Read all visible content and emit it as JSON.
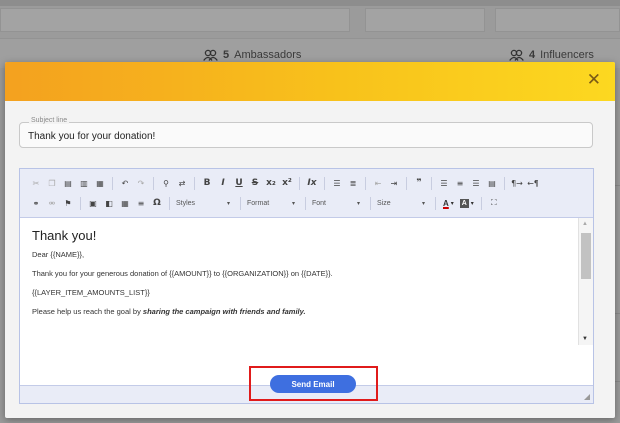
{
  "background": {
    "stats": [
      {
        "icon": "people-icon",
        "count": "5",
        "label": "Ambassadors"
      },
      {
        "icon": "people-icon",
        "count": "4",
        "label": "Influencers"
      }
    ]
  },
  "modal": {
    "close_glyph": "✕",
    "header_gradient": [
      "#f4a11f",
      "#fcd820"
    ],
    "subject": {
      "label": "Subject line",
      "value": "Thank you for your donation!"
    },
    "toolbar": {
      "row1": [
        "cut-icon",
        "copy-icon",
        "paste-icon",
        "paste-text-icon",
        "paste-word-icon",
        "undo-icon",
        "redo-icon",
        "find-icon",
        "replace-icon",
        "bold-icon",
        "italic-icon",
        "underline-icon",
        "strike-icon",
        "subscript-icon",
        "superscript-icon",
        "remove-format-icon",
        "numbered-list-icon",
        "bulleted-list-icon",
        "outdent-icon",
        "indent-icon",
        "blockquote-icon",
        "align-left-icon",
        "align-center-icon",
        "align-right-icon",
        "align-justify-icon",
        "ltr-icon",
        "rtl-icon"
      ],
      "combos": {
        "styles": "Styles",
        "format": "Format",
        "font": "Font",
        "size": "Size"
      }
    },
    "content": {
      "heading": "Thank you!",
      "greeting": "Dear {{NAME}},",
      "line1": "Thank you for your generous donation of {{AMOUNT}} to {{ORGANIZATION}} on {{DATE}}.",
      "line2": "{{LAYER_ITEM_AMOUNTS_LIST}}",
      "line3_prefix": "Please help us reach the goal by ",
      "line3_bold": "sharing the campaign with friends and family."
    },
    "send_button": "Send Email",
    "accent_color": "#3e6fe0",
    "highlight_color": "#e01b1b"
  }
}
